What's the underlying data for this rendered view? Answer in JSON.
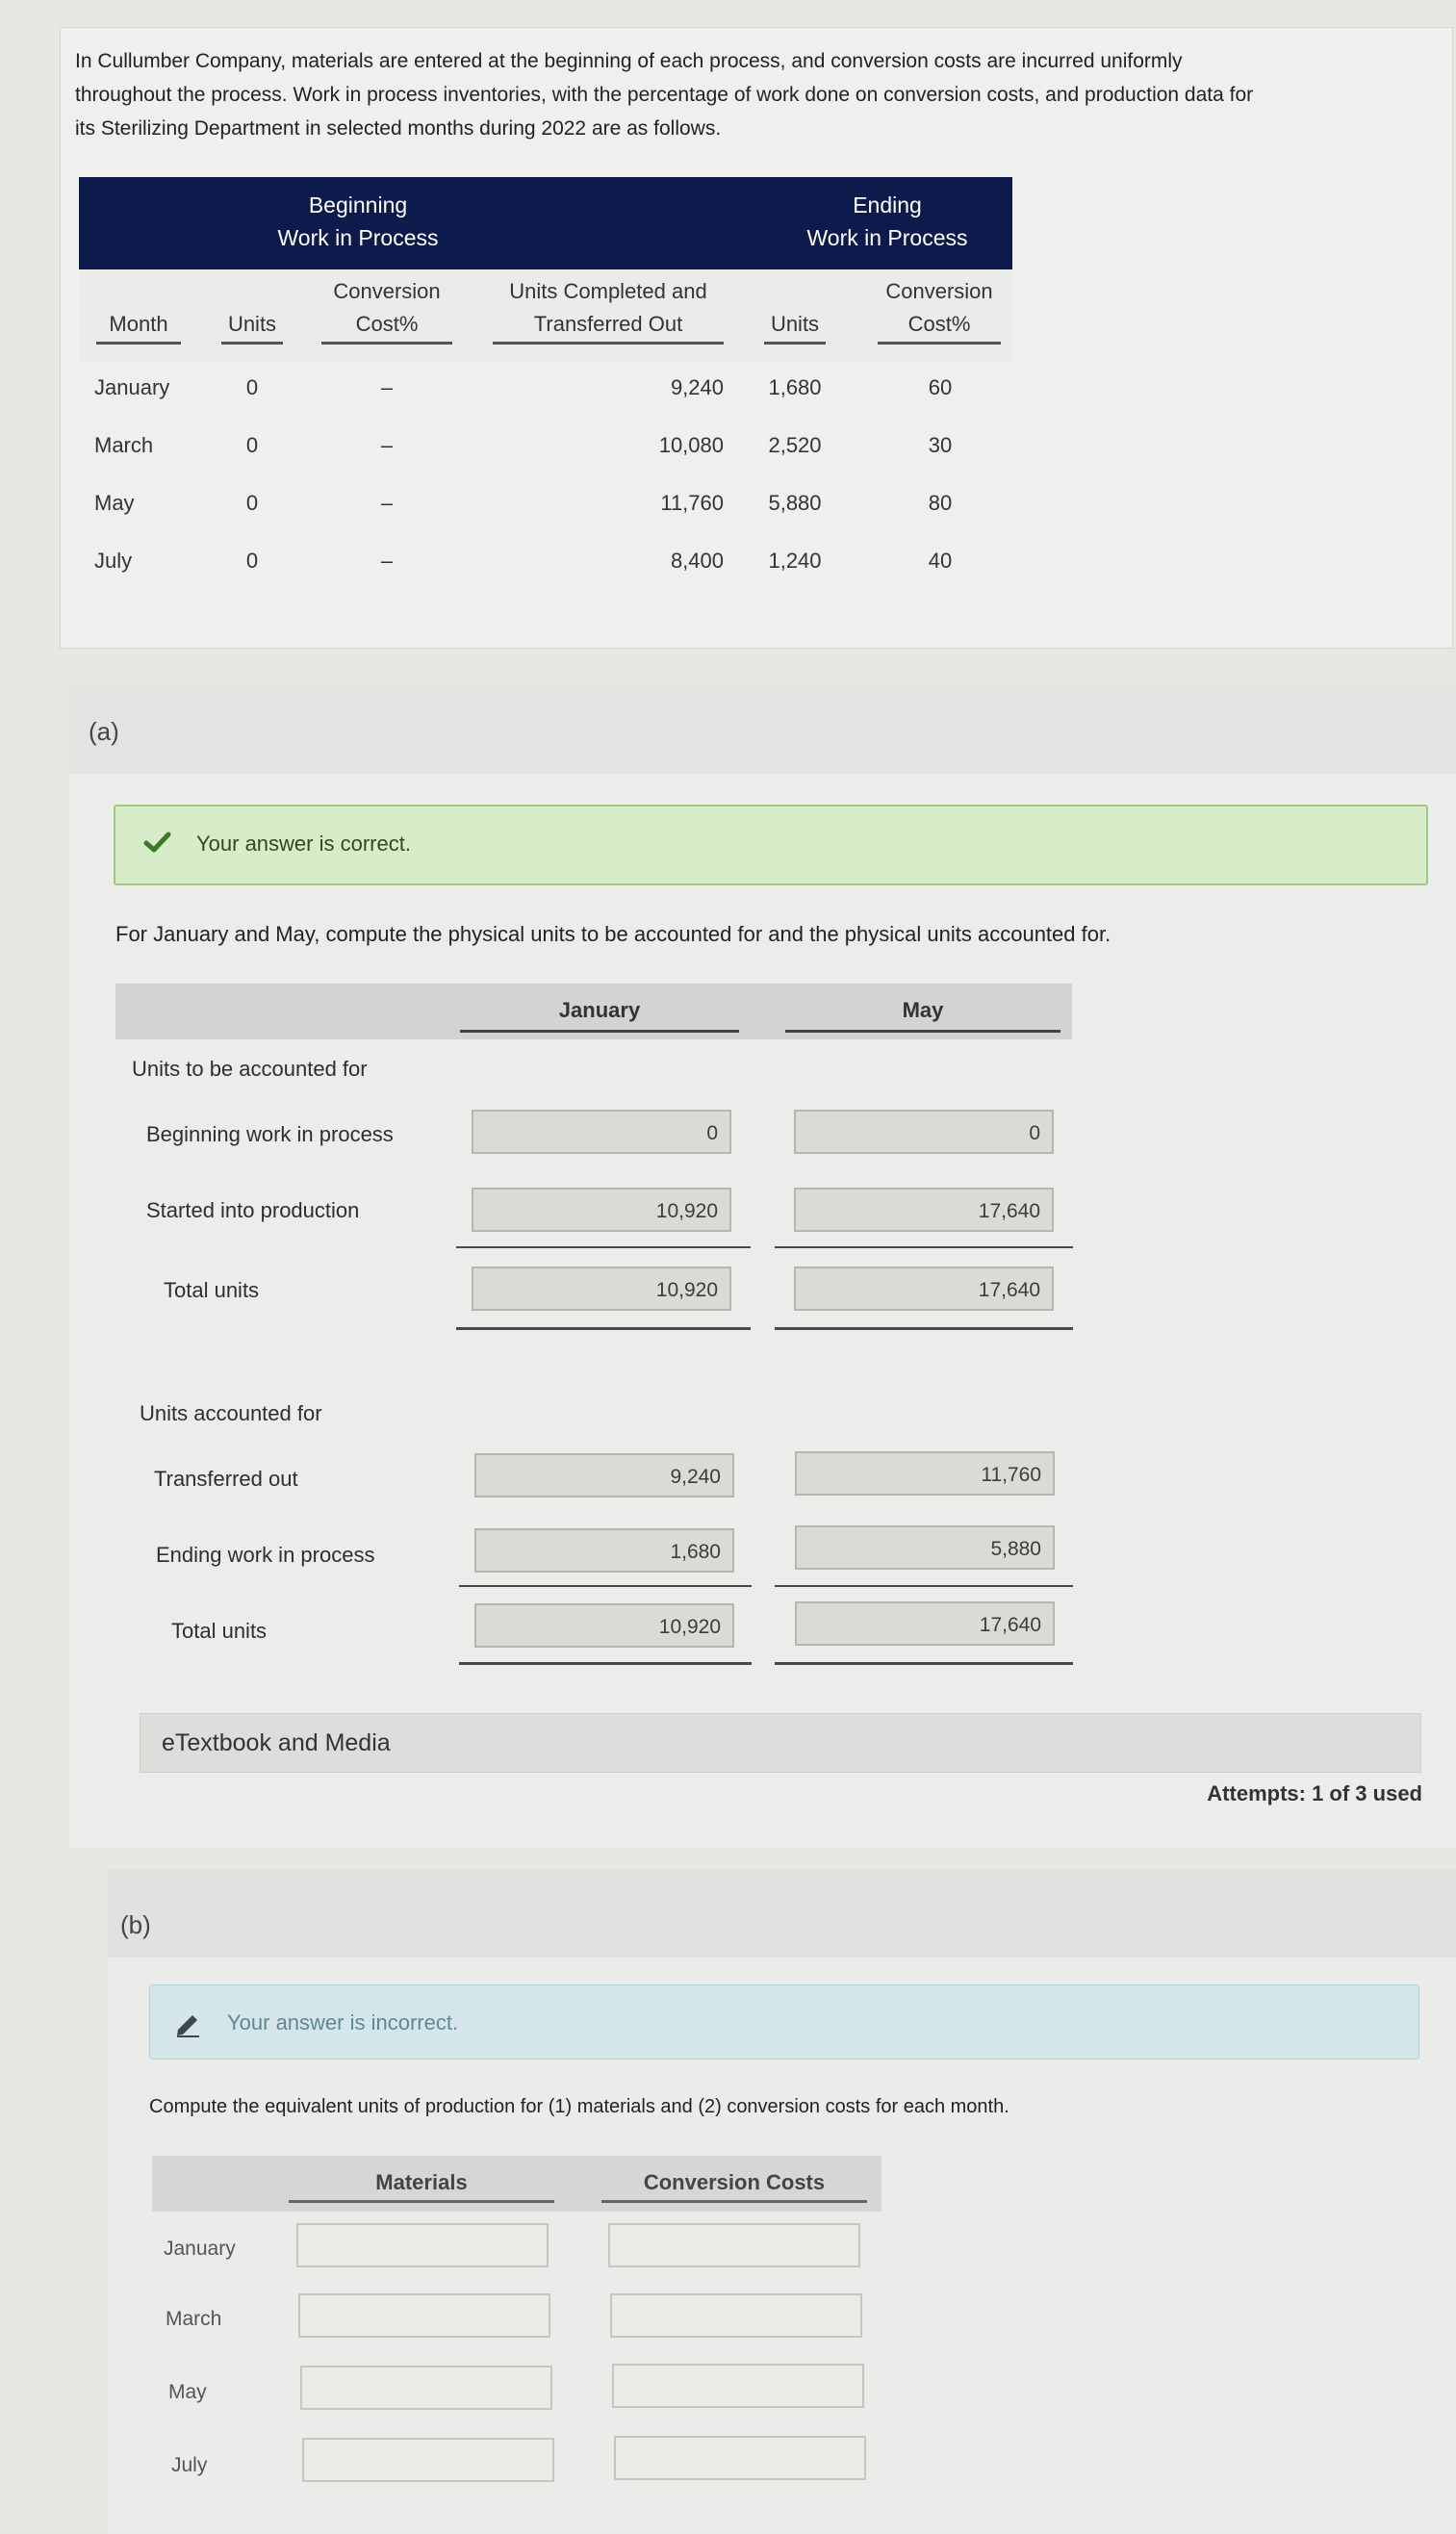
{
  "problem": {
    "line1": "In Cullumber Company, materials are entered at the beginning of each process, and conversion costs are incurred uniformly",
    "line2": "throughout the process. Work in process inventories, with the percentage of work done on conversion costs, and production data for",
    "line3": "its Sterilizing Department in selected months during 2022 are as follows."
  },
  "data_table": {
    "group_beginning": [
      "Beginning",
      "Work in Process"
    ],
    "group_ending": [
      "Ending",
      "Work in Process"
    ],
    "col_month": "Month",
    "col_units": "Units",
    "col_conv_beg": [
      "Conversion",
      "Cost%"
    ],
    "col_completed": [
      "Units Completed and",
      "Transferred Out"
    ],
    "col_units_end": "Units",
    "col_conv_end": [
      "Conversion",
      "Cost%"
    ],
    "rows": [
      {
        "month": "January",
        "beg_units": "0",
        "beg_conv": "–",
        "completed": "9,240",
        "end_units": "1,680",
        "end_conv": "60"
      },
      {
        "month": "March",
        "beg_units": "0",
        "beg_conv": "–",
        "completed": "10,080",
        "end_units": "2,520",
        "end_conv": "30"
      },
      {
        "month": "May",
        "beg_units": "0",
        "beg_conv": "–",
        "completed": "11,760",
        "end_units": "5,880",
        "end_conv": "80"
      },
      {
        "month": "July",
        "beg_units": "0",
        "beg_conv": "–",
        "completed": "8,400",
        "end_units": "1,240",
        "end_conv": "40"
      }
    ]
  },
  "part_a": {
    "label": "(a)",
    "feedback": "Your answer is correct.",
    "instruction": "For January and May, compute the physical units to be accounted for and the physical units accounted for.",
    "col_jan": "January",
    "col_may": "May",
    "section_to_account": "Units to be accounted for",
    "row_beg_wip": "Beginning work in process",
    "row_started": "Started into production",
    "row_total1": "Total units",
    "section_accounted": "Units accounted for",
    "row_transferred": "Transferred out",
    "row_end_wip": "Ending work in process",
    "row_total2": "Total units",
    "values": {
      "jan_beg": "0",
      "may_beg": "0",
      "jan_started": "10,920",
      "may_started": "17,640",
      "jan_total1": "10,920",
      "may_total1": "17,640",
      "jan_transferred": "9,240",
      "may_transferred": "11,760",
      "jan_end": "1,680",
      "may_end": "5,880",
      "jan_total2": "10,920",
      "may_total2": "17,640"
    },
    "etextbook": "eTextbook and Media",
    "attempts": "Attempts: 1 of 3 used"
  },
  "part_b": {
    "label": "(b)",
    "feedback": "Your answer is incorrect.",
    "instruction": "Compute the equivalent units of production for (1) materials and (2) conversion costs for each month.",
    "col_materials": "Materials",
    "col_conversion": "Conversion Costs",
    "months": [
      "January",
      "March",
      "May",
      "July"
    ]
  },
  "colors": {
    "header_navy": "#0c1a4c",
    "success_bg": "#d7ecc9",
    "error_bg": "#d5e6ea"
  }
}
